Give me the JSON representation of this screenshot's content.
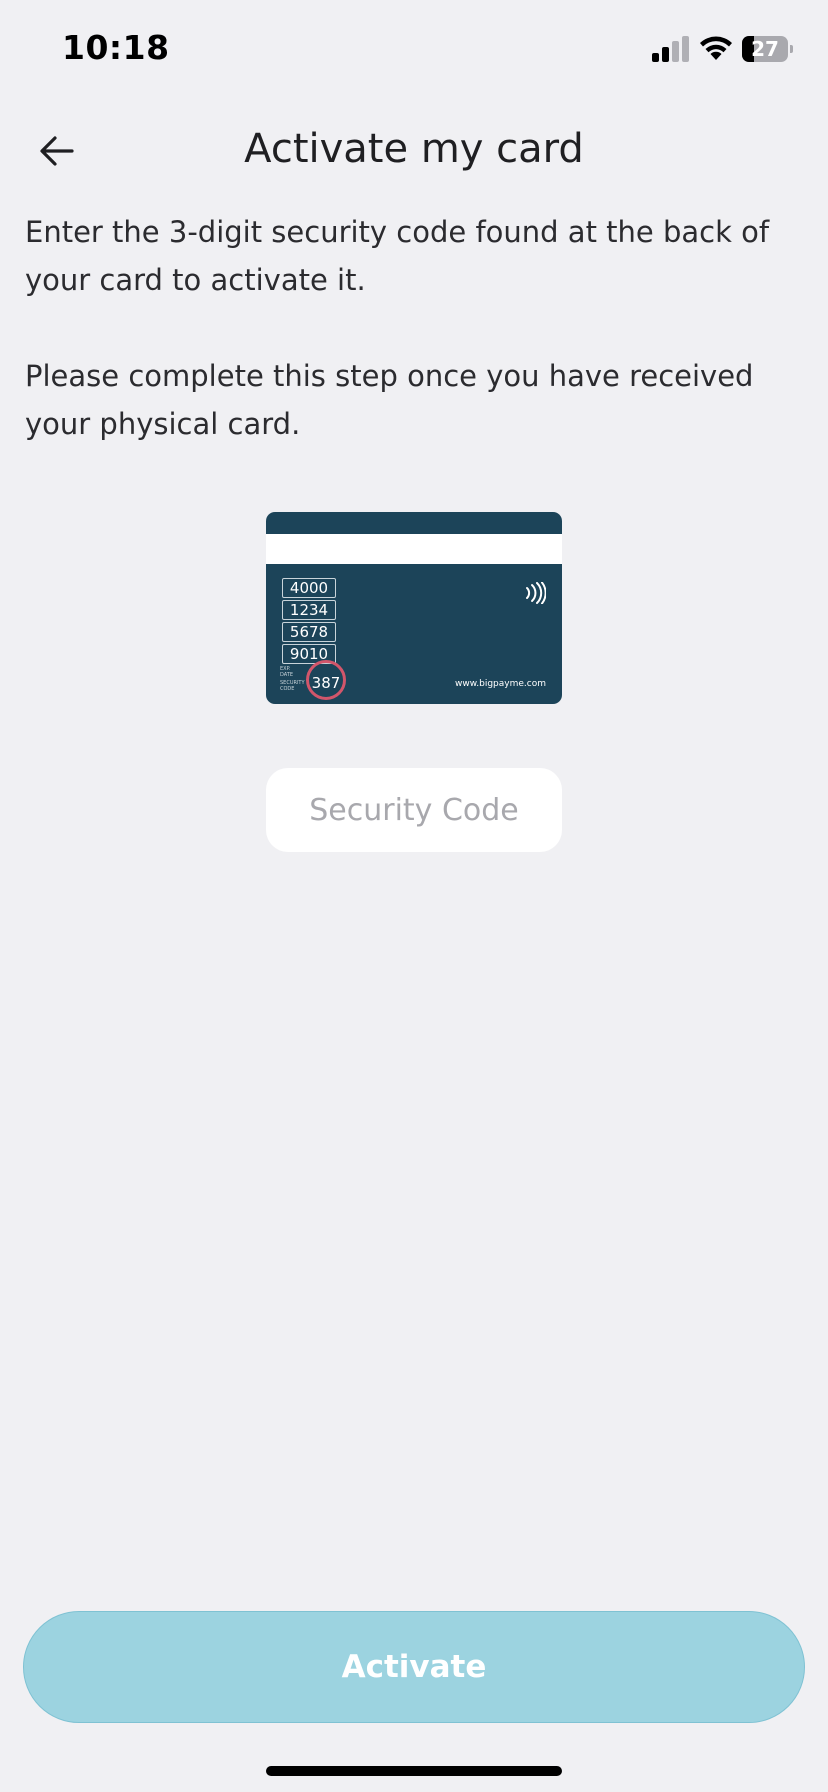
{
  "status_bar": {
    "time": "10:18",
    "battery_level": "27",
    "battery_fraction": 0.27
  },
  "header": {
    "title": "Activate my card",
    "back_icon": "arrow-left-icon"
  },
  "instructions": {
    "line1": "Enter the 3-digit security code found at the back of your card to activate it.",
    "line2": "Please complete this step once you have received your physical card."
  },
  "card_illustration": {
    "numbers": [
      "4000",
      "1234",
      "5678",
      "9010"
    ],
    "small_label_1": "EXP. DATE",
    "small_label_2": "SECURITY CODE",
    "security_code": "387",
    "website": "www.bigpayme.com",
    "contactless_icon": "contactless-icon",
    "card_color": "#1c4459",
    "highlight_color": "#d2566b"
  },
  "security_field": {
    "placeholder": "Security Code",
    "value": ""
  },
  "actions": {
    "activate_label": "Activate",
    "activate_color": "#9cd3e0"
  }
}
